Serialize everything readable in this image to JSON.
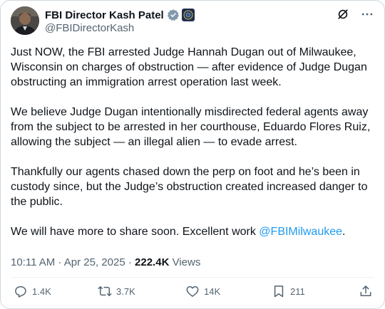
{
  "author": {
    "display_name": "FBI Director Kash Patel",
    "handle": "@FBIDirectorKash",
    "verified_icon": "verified-check-icon",
    "affiliate_icon": "fbi-seal-badge-icon"
  },
  "header_icons": [
    "grok-icon",
    "more-icon"
  ],
  "tweet": {
    "p1": "Just NOW, the FBI arrested Judge Hannah Dugan out of Milwaukee, Wisconsin on charges of obstruction — after evidence of Judge Dugan obstructing an immigration arrest operation last week.",
    "p2": "We believe Judge Dugan intentionally misdirected federal agents away from the subject to be arrested in her courthouse, Eduardo Flores Ruiz, allowing the subject — an illegal alien — to evade arrest.",
    "p3": "Thankfully our agents chased down the perp on foot and he’s been in custody since, but the Judge’s obstruction created increased danger to the public.",
    "p4_text": "We will have more to share soon. Excellent work ",
    "p4_mention": "@FBIMilwaukee",
    "p4_end": "."
  },
  "meta": {
    "time": "10:11 AM",
    "sep1": " · ",
    "date": "Apr 25, 2025",
    "sep2": " · ",
    "views_count": "222.4K",
    "views_label": " Views"
  },
  "actions": {
    "replies": "1.4K",
    "reposts": "3.7K",
    "likes": "14K",
    "bookmarks": "211"
  },
  "colors": {
    "accent": "#1d9bf0",
    "text": "#0f1419",
    "secondary": "#536471",
    "border": "#cfd9de"
  }
}
